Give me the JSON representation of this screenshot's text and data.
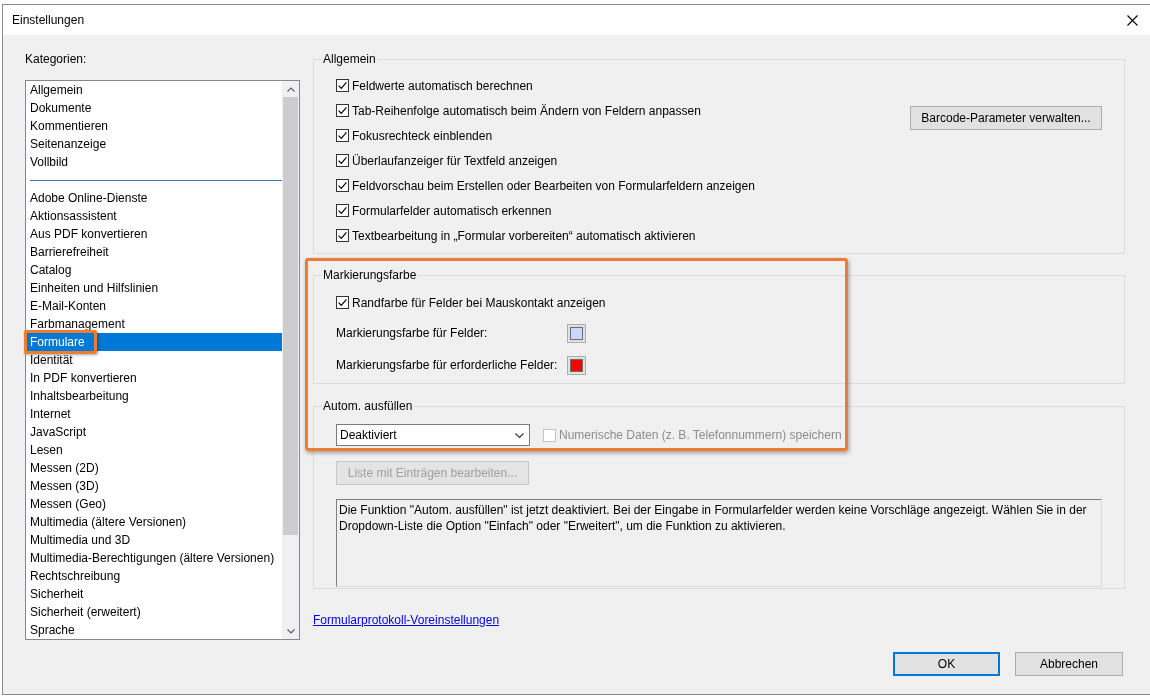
{
  "window": {
    "title": "Einstellungen"
  },
  "categories": {
    "label": "Kategorien:",
    "sections": [
      {
        "items": [
          {
            "label": "Allgemein",
            "selected": false,
            "highlighted": false
          },
          {
            "label": "Dokumente",
            "selected": false,
            "highlighted": false
          },
          {
            "label": "Kommentieren",
            "selected": false,
            "highlighted": false
          },
          {
            "label": "Seitenanzeige",
            "selected": false,
            "highlighted": false
          },
          {
            "label": "Vollbild",
            "selected": false,
            "highlighted": false
          }
        ]
      },
      {
        "items": [
          {
            "label": "Adobe Online-Dienste",
            "selected": false,
            "highlighted": false
          },
          {
            "label": "Aktionsassistent",
            "selected": false,
            "highlighted": false
          },
          {
            "label": "Aus PDF konvertieren",
            "selected": false,
            "highlighted": false
          },
          {
            "label": "Barrierefreiheit",
            "selected": false,
            "highlighted": false
          },
          {
            "label": "Catalog",
            "selected": false,
            "highlighted": false
          },
          {
            "label": "Einheiten und Hilfslinien",
            "selected": false,
            "highlighted": false
          },
          {
            "label": "E-Mail-Konten",
            "selected": false,
            "highlighted": false
          },
          {
            "label": "Farbmanagement",
            "selected": false,
            "highlighted": false
          },
          {
            "label": "Formulare",
            "selected": true,
            "highlighted": true
          },
          {
            "label": "Identität",
            "selected": false,
            "highlighted": false
          },
          {
            "label": "In PDF konvertieren",
            "selected": false,
            "highlighted": false
          },
          {
            "label": "Inhaltsbearbeitung",
            "selected": false,
            "highlighted": false
          },
          {
            "label": "Internet",
            "selected": false,
            "highlighted": false
          },
          {
            "label": "JavaScript",
            "selected": false,
            "highlighted": false
          },
          {
            "label": "Lesen",
            "selected": false,
            "highlighted": false
          },
          {
            "label": "Messen (2D)",
            "selected": false,
            "highlighted": false
          },
          {
            "label": "Messen (3D)",
            "selected": false,
            "highlighted": false
          },
          {
            "label": "Messen (Geo)",
            "selected": false,
            "highlighted": false
          },
          {
            "label": "Multimedia (ältere Versionen)",
            "selected": false,
            "highlighted": false
          },
          {
            "label": "Multimedia und 3D",
            "selected": false,
            "highlighted": false
          },
          {
            "label": "Multimedia-Berechtigungen (ältere Versionen)",
            "selected": false,
            "highlighted": false
          },
          {
            "label": "Rechtschreibung",
            "selected": false,
            "highlighted": false
          },
          {
            "label": "Sicherheit",
            "selected": false,
            "highlighted": false
          },
          {
            "label": "Sicherheit (erweitert)",
            "selected": false,
            "highlighted": false
          },
          {
            "label": "Sprache",
            "selected": false,
            "highlighted": false
          }
        ]
      }
    ]
  },
  "general": {
    "title": "Allgemein",
    "options": [
      {
        "label": "Feldwerte automatisch berechnen",
        "checked": true
      },
      {
        "label": "Tab-Reihenfolge automatisch beim Ändern von Feldern anpassen",
        "checked": true
      },
      {
        "label": "Fokusrechteck einblenden",
        "checked": true
      },
      {
        "label": "Überlaufanzeiger für Textfeld anzeigen",
        "checked": true
      },
      {
        "label": "Feldvorschau beim Erstellen oder Bearbeiten von Formularfeldern anzeigen",
        "checked": true
      },
      {
        "label": "Formularfelder automatisch erkennen",
        "checked": true
      },
      {
        "label": "Textbearbeitung in „Formular vorbereiten“ automatisch aktivieren",
        "checked": true
      }
    ],
    "button": "Barcode-Parameter verwalten..."
  },
  "highlight_color": {
    "title": "Markierungsfarbe",
    "highlighted": true,
    "option": {
      "label": "Randfarbe für Felder bei Mauskontakt anzeigen",
      "checked": true
    },
    "colors": [
      {
        "label": "Markierungsfarbe für Felder:",
        "color": "#cdd6ff"
      },
      {
        "label": "Markierungsfarbe für erforderliche Felder:",
        "color": "#ff0000"
      }
    ]
  },
  "autofill": {
    "title": "Autom. ausfüllen",
    "mode": "Deaktiviert",
    "numeric_option": {
      "label": "Numerische Daten (z. B. Telefonnummern) speichern",
      "checked": false,
      "disabled": true
    },
    "edit_button": {
      "label": "Liste mit Einträgen bearbeiten...",
      "disabled": true
    },
    "description": "Die Funktion \"Autom. ausfüllen\" ist jetzt deaktiviert. Bei der Eingabe in Formularfelder werden keine Vorschläge angezeigt. Wählen Sie in der Dropdown-Liste die Option \"Einfach\" oder \"Erweitert\", um die Funktion zu aktivieren."
  },
  "link": "Formularprotokoll-Voreinstellungen",
  "buttons": [
    {
      "label": "OK",
      "default": true
    },
    {
      "label": "Abbrechen",
      "default": false
    }
  ]
}
